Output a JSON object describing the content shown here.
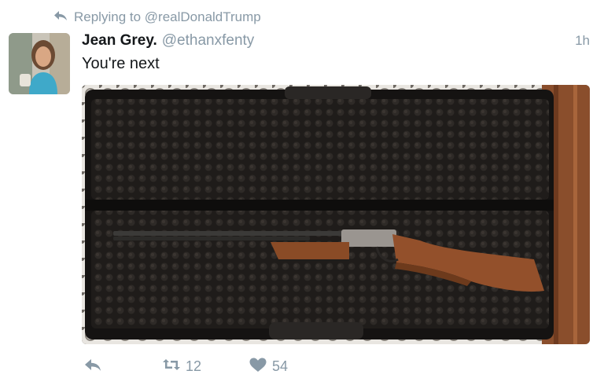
{
  "reply_context": {
    "text": "Replying to @realDonaldTrump",
    "icon": "reply-icon"
  },
  "tweet": {
    "display_name": "Jean Grey.",
    "handle": "@ethanxfenty",
    "timestamp": "1h",
    "text": "You're next",
    "media_description_icon": "photo"
  },
  "actions": {
    "reply_icon": "reply-icon",
    "retweet_icon": "retweet-icon",
    "retweet_count": "12",
    "like_icon": "heart-icon",
    "like_count": "54"
  },
  "colors": {
    "muted": "#8899a6",
    "text": "#14171a",
    "background": "#ffffff"
  }
}
